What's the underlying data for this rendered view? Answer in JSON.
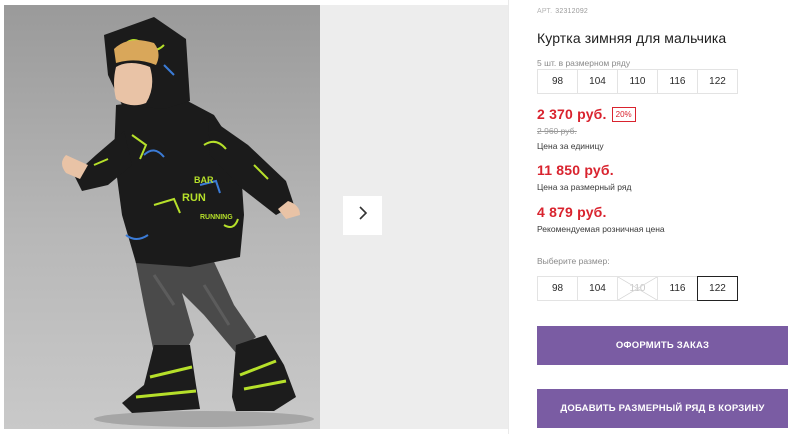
{
  "product": {
    "sku_label": "АРТ.",
    "sku_value": "32312092",
    "title": "Куртка зимняя для мальчика"
  },
  "size_range": {
    "caption": "5 шт. в размерном ряду",
    "sizes": [
      "98",
      "104",
      "110",
      "116",
      "122"
    ]
  },
  "pricing": {
    "unit_price": "2 370 руб.",
    "discount": "20%",
    "old_price": "2 960 руб.",
    "unit_caption": "Цена за единицу",
    "range_price": "11 850 руб.",
    "range_caption": "Цена за размерный ряд",
    "retail_price": "4 879 руб.",
    "retail_caption": "Рекомендуемая розничная цена",
    "price_color": "#d9232e"
  },
  "size_select": {
    "caption": "Выберите размер:",
    "options": [
      {
        "label": "98",
        "state": "available"
      },
      {
        "label": "104",
        "state": "available"
      },
      {
        "label": "110",
        "state": "unavailable"
      },
      {
        "label": "116",
        "state": "available"
      },
      {
        "label": "122",
        "state": "selected"
      }
    ]
  },
  "actions": {
    "order_label": "ОФОРМИТЬ ЗАКАЗ",
    "cart_label": "ДОБАВИТЬ РАЗМЕРНЫЙ РЯД В КОРЗИНУ",
    "button_color": "#7a5ca3"
  },
  "gallery": {
    "next_icon": "chevron-right-icon",
    "photo_print": [
      "BAR",
      "RUN",
      "RUNNING"
    ]
  }
}
